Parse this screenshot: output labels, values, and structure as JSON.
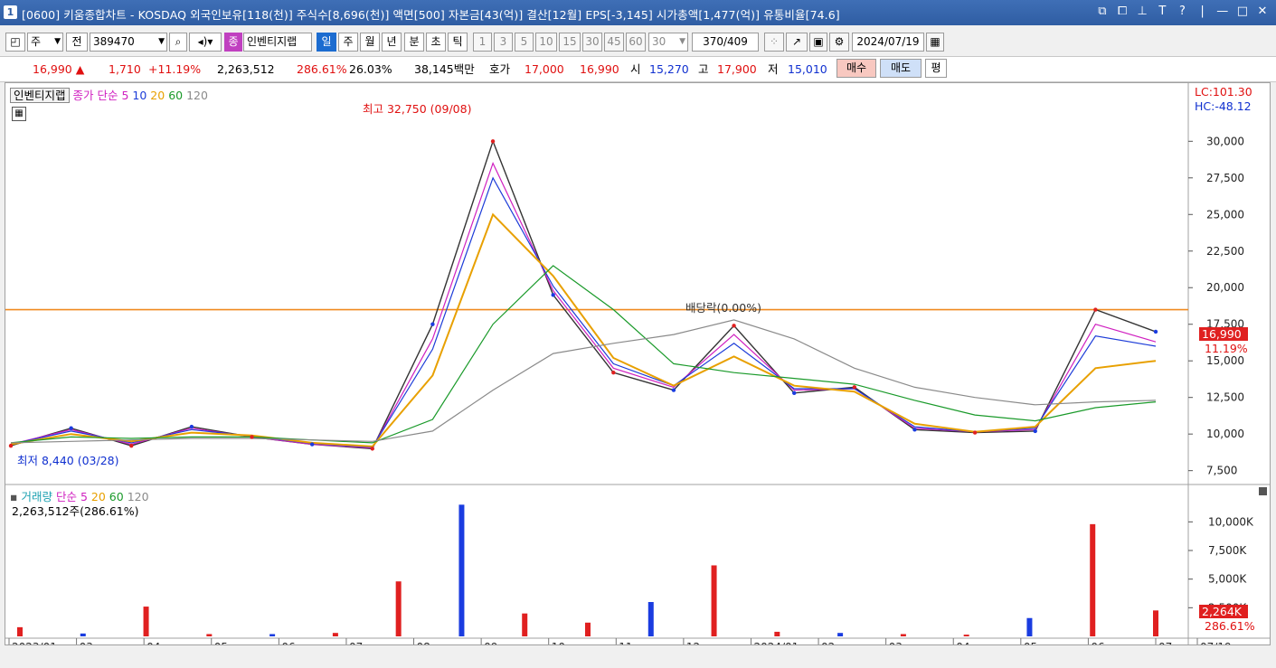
{
  "titlebar": {
    "window_number": "1",
    "title": "[0600] 키움종합차트 - KOSDAQ 외국인보유[118(천)] 주식수[8,696(천)] 액면[500] 자본금[43(억)] 결산[12월] EPS[-3,145] 시가총액[1,477(억)] 유통비율[74.6]",
    "controls": [
      "⧉",
      "⧠",
      "⊥",
      "T",
      "?",
      "|",
      "—",
      "□",
      "✕"
    ]
  },
  "toolbar": {
    "market_type": "주",
    "all_label": "전",
    "stock_code": "389470",
    "stock_badge": "종",
    "stock_name": "인벤티지랩",
    "period_tabs": [
      "일",
      "주",
      "월",
      "년",
      "분",
      "초",
      "틱"
    ],
    "selected_period": "일",
    "minute_options": [
      "1",
      "3",
      "5",
      "10",
      "15",
      "30",
      "45",
      "60"
    ],
    "interval_value": "30",
    "count_value": "370",
    "count_total": "/409",
    "date_value": "2024/07/19"
  },
  "quote": {
    "price": "16,990",
    "arrow": "▲",
    "change": "1,710",
    "change_pct": "+11.19%",
    "volume": "2,263,512",
    "volume_ratio": "286.61%",
    "turnover": "26.03%",
    "amount": "38,145백만",
    "hoga_label": "호가",
    "ask": "17,000",
    "bid": "16,990",
    "open_label": "시",
    "open": "15,270",
    "high_label": "고",
    "high": "17,900",
    "low_label": "저",
    "low": "15,010",
    "buy_label": "매수",
    "sell_label": "매도",
    "eval_label": "평"
  },
  "price_panel": {
    "name_tag": "인벤티지랩",
    "legend_prefix": "종가 단순",
    "ma_periods": [
      "5",
      "10",
      "20",
      "60",
      "120"
    ],
    "ma_colors": [
      "#d020c0",
      "#1c3cd8",
      "#e8a000",
      "#1a9a2a",
      "#8a8a8a"
    ],
    "lc_label": "LC:101.30",
    "hc_label": "HC:-48.12",
    "highest_annotation": "최고 32,750 (09/08)",
    "lowest_annotation": "최저 8,440 (03/28)",
    "dividend_annotation": "배당락(0.00%)",
    "current_price_tag": "16,990",
    "current_pct_tag": "11.19%",
    "horizontal_line_color": "#f08a20"
  },
  "volume_panel": {
    "legend_prefix": "거래량",
    "legend_type": "단순",
    "ma_periods": [
      "5",
      "20",
      "60",
      "120"
    ],
    "current_volume_text": "2,263,512주(286.61%)",
    "current_volume_tag": "2,264K",
    "current_pct_tag": "286.61%"
  },
  "x_axis": {
    "labels": [
      "2023/01",
      "03",
      "04",
      "05",
      "06",
      "07",
      "08",
      "09",
      "10",
      "11",
      "12",
      "2024/01",
      "02",
      "03",
      "04",
      "05",
      "06",
      "07",
      "07/19"
    ]
  },
  "chart_data": [
    {
      "type": "line",
      "title": "",
      "xlabel": "",
      "ylabel": "",
      "ylim": [
        6800,
        33600
      ],
      "y_ticks": [
        "7,500",
        "10,000",
        "12,500",
        "15,000",
        "17,500",
        "20,000",
        "22,500",
        "25,000",
        "27,500",
        "30,000"
      ],
      "y_tick_values": [
        7500,
        10000,
        12500,
        15000,
        17500,
        20000,
        22500,
        25000,
        27500,
        30000
      ],
      "horizontal_line_value": 18500,
      "x": [
        "2023/01",
        "02",
        "03",
        "04",
        "05",
        "06",
        "07",
        "08",
        "09",
        "10",
        "11",
        "12",
        "2024/01",
        "02",
        "03",
        "04",
        "05",
        "06",
        "07",
        "07/19"
      ],
      "series": [
        {
          "name": "종가",
          "color": "#333333",
          "values": [
            9200,
            10400,
            9200,
            10500,
            9800,
            9300,
            9000,
            17500,
            30000,
            19500,
            14200,
            13000,
            17400,
            12800,
            13200,
            10300,
            10100,
            10200,
            18500,
            16990
          ]
        },
        {
          "name": "5",
          "color": "#d020c0",
          "values": [
            9300,
            10300,
            9300,
            10400,
            9800,
            9300,
            9050,
            16500,
            28500,
            19800,
            14500,
            13200,
            16800,
            13000,
            13100,
            10400,
            10150,
            10300,
            17500,
            16300
          ]
        },
        {
          "name": "10",
          "color": "#1c3cd8",
          "values": [
            9300,
            10200,
            9400,
            10300,
            9850,
            9350,
            9100,
            15800,
            27500,
            20100,
            14800,
            13300,
            16200,
            13100,
            13100,
            10500,
            10150,
            10400,
            16700,
            16000
          ]
        },
        {
          "name": "20",
          "color": "#e8a000",
          "values": [
            9300,
            10000,
            9500,
            10100,
            9900,
            9400,
            9150,
            14000,
            25000,
            20800,
            15200,
            13300,
            15300,
            13300,
            12900,
            10700,
            10150,
            10500,
            14500,
            15000
          ]
        },
        {
          "name": "60",
          "color": "#1a9a2a",
          "values": [
            9400,
            9800,
            9700,
            9800,
            9800,
            9600,
            9400,
            11000,
            17500,
            21500,
            18500,
            14800,
            14200,
            13800,
            13400,
            12300,
            11300,
            10900,
            11800,
            12200
          ]
        },
        {
          "name": "120",
          "color": "#8a8a8a",
          "values": [
            9400,
            9500,
            9600,
            9700,
            9700,
            9600,
            9500,
            10200,
            13000,
            15500,
            16200,
            16800,
            17800,
            16500,
            14500,
            13200,
            12500,
            12000,
            12200,
            12300
          ]
        }
      ]
    },
    {
      "type": "bar",
      "title": "",
      "xlabel": "",
      "ylabel": "",
      "ylim": [
        0,
        12000
      ],
      "y_ticks": [
        "2,500K",
        "5,000K",
        "7,500K",
        "10,000K"
      ],
      "y_tick_values": [
        2500,
        5000,
        7500,
        10000
      ],
      "categories": [
        "2023/01",
        "03",
        "04",
        "05",
        "06",
        "07",
        "08",
        "09",
        "10",
        "11",
        "12",
        "2024/01",
        "02",
        "03",
        "04",
        "05",
        "06",
        "07",
        "07/19"
      ],
      "series": [
        {
          "name": "거래량",
          "values": [
            800,
            250,
            2600,
            200,
            200,
            300,
            4800,
            11500,
            2000,
            1200,
            3000,
            6200,
            400,
            300,
            200,
            150,
            1600,
            9800,
            2264
          ]
        }
      ]
    }
  ]
}
